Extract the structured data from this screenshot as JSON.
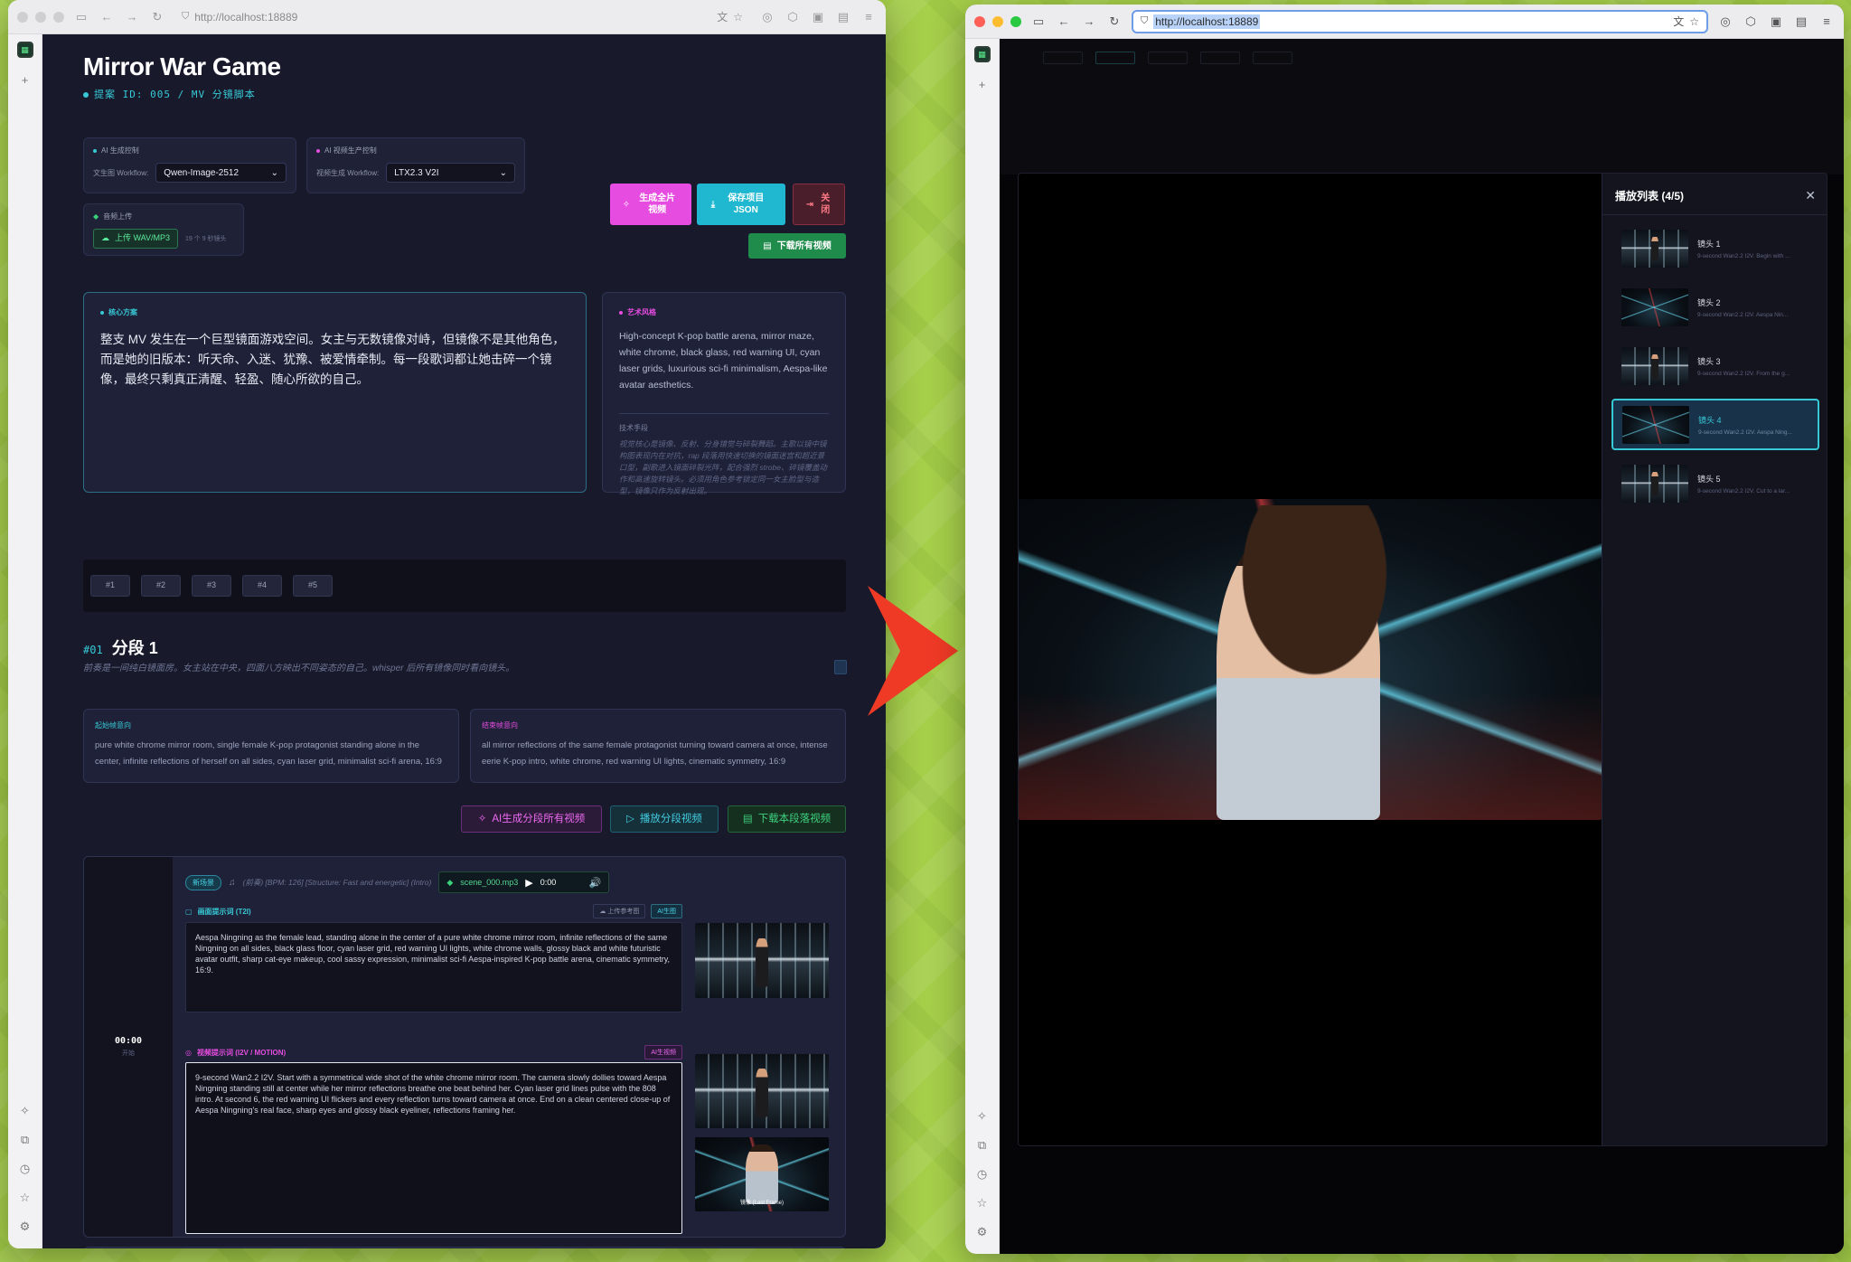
{
  "browser": {
    "url": "http://localhost:18889"
  },
  "project": {
    "title": "Mirror War Game",
    "subtitle": "提案 ID: 005 / MV 分镜脚本"
  },
  "controls": {
    "ai_gen": {
      "label": "AI 生成控制",
      "field_label": "文生图 Workflow:",
      "value": "Qwen-Image-2512"
    },
    "ai_video": {
      "label": "AI 视频生产控制",
      "field_label": "视频生成 Workflow:",
      "value": "LTX2.3 V2I"
    },
    "audio": {
      "label": "音频上传",
      "button": "上传 WAV/MP3",
      "hint": "19 个 9 秒镜头"
    }
  },
  "actions": {
    "generate": "生成全片视频",
    "save": "保存项目 JSON",
    "close": "关闭",
    "download_all": "下载所有视频"
  },
  "concept": {
    "label": "核心方案",
    "text": "整支 MV 发生在一个巨型镜面游戏空间。女主与无数镜像对峙，但镜像不是其他角色，而是她的旧版本：听天命、入迷、犹豫、被爱情牵制。每一段歌词都让她击碎一个镜像，最终只剩真正清醒、轻盈、随心所欲的自己。"
  },
  "art_style": {
    "label": "艺术风格",
    "text": "High-concept K-pop battle arena, mirror maze, white chrome, black glass, red warning UI, cyan laser grids, luxurious sci-fi minimalism, Aespa-like avatar aesthetics.",
    "tech_label": "技术手段",
    "tech_text": "视觉核心是镜像、反射、分身错觉与碎裂舞蹈。主歌以镜中镜构图表现内在对抗，rap 段落用快速切换的镜面迷宫和超近景口型，副歌进入镜面碎裂光阵，配合强烈 strobe、碎镜覆盖动作和高速旋转镜头。必须用角色参考锁定同一女主脸型与造型，镜像只作为反射出现。"
  },
  "segment_tabs": [
    "#1",
    "#2",
    "#3",
    "#4",
    "#5"
  ],
  "segment": {
    "num": "#01",
    "title": "分段 1",
    "desc": "前奏是一间纯白镜面房。女主站在中央，四面八方映出不同姿态的自己。whisper 后所有镜像同时看向镜头。",
    "start_label": "起始帧意向",
    "start_text": "pure white chrome mirror room, single female K-pop protagonist standing alone in the center, infinite reflections of herself on all sides, cyan laser grid, minimalist sci-fi arena, 16:9",
    "end_label": "结束帧意向",
    "end_text": "all mirror reflections of the same female protagonist turning toward camera at once, intense eerie K-pop intro, white chrome, red warning UI lights, cinematic symmetry, 16:9",
    "btn_ai": "AI生成分段所有视频",
    "btn_play": "播放分段视频",
    "btn_download": "下载本段落视频"
  },
  "shot": {
    "time": "00:00",
    "time_label": "开始",
    "tag": "新场景",
    "music": "(前奏) [BPM: 126] [Structure: Fast and energetic] (Intro)",
    "audio_file": "scene_000.mp3",
    "audio_time": "0:00",
    "t2i_label": "画面提示词 (T2I)",
    "upload_ref": "上传参考图",
    "ai_gen": "AI生图",
    "t2i_text": "Aespa Ningning as the female lead, standing alone in the center of a pure white chrome mirror room, infinite reflections of the same Ningning on all sides, black glass floor, cyan laser grid, red warning UI lights, white chrome walls, glossy black and white futuristic avatar outfit, sharp cat-eye makeup, cool sassy expression, minimalist sci-fi Aespa-inspired K-pop battle arena, cinematic symmetry, 16:9.",
    "i2v_label": "视频提示词 (I2V / MOTION)",
    "ai_vid": "AI生视频",
    "i2v_text": "9-second Wan2.2 I2V. Start with a symmetrical wide shot of the white chrome mirror room. The camera slowly dollies toward Aespa Ningning standing still at center while her mirror reflections breathe one beat behind her. Cyan laser grid lines pulse with the 808 intro. At second 6, the red warning UI flickers and every reflection turns toward camera at once. End on a clean centered close-up of Aespa Ningning's real face, sharp eyes and glossy black eyeliner, reflections framing her.",
    "thumb_caption": "镜像 (Last Frame)"
  },
  "player": {
    "playlist_title": "播放列表 (4/5)",
    "items": [
      {
        "label": "镜头 1",
        "desc": "9-second Wan2.2 I2V. Begin with ..."
      },
      {
        "label": "镜头 2",
        "desc": "9-second Wan2.2 I2V. Aespa Nin..."
      },
      {
        "label": "镜头 3",
        "desc": "9-second Wan2.2 I2V. From the g..."
      },
      {
        "label": "镜头 4",
        "desc": "9-second Wan2.2 I2V. Aespa Ning..."
      },
      {
        "label": "镜头 5",
        "desc": "9-second Wan2.2 I2V. Cut to a lar..."
      }
    ],
    "active_index": 3
  },
  "colors": {
    "accent_cyan": "#37c9d6",
    "accent_magenta": "#e64ce0",
    "accent_green": "#1f9a54",
    "accent_red": "#ef3a26",
    "bg_dark": "#181a2c"
  }
}
